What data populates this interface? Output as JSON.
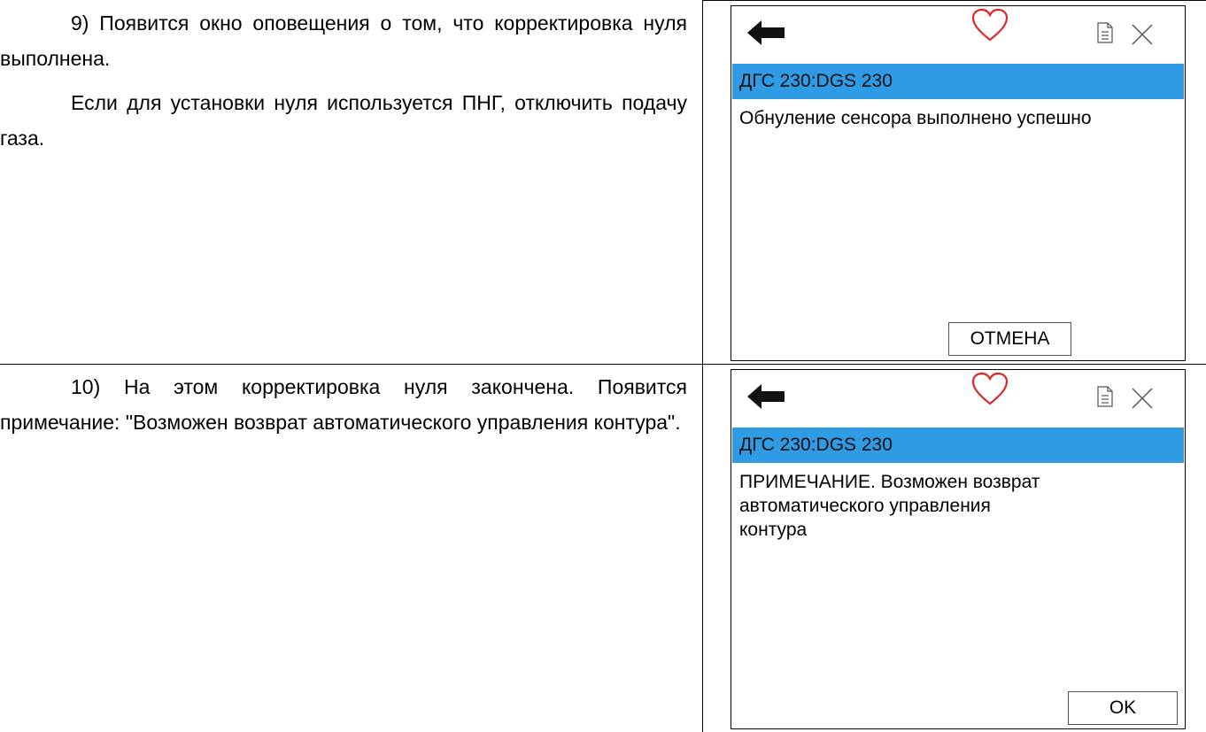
{
  "rows": [
    {
      "step_text": "9) Появится окно оповещения о том, что корректировка нуля выполнена.",
      "step_text_2": "Если для установки нуля используется ПНГ, отключить подачу газа.",
      "screen": {
        "title": "ДГС 230:DGS 230",
        "message": "Обнуление сенсора выполнено успешно",
        "button_label": "ОТМЕНА",
        "icons": [
          "back-arrow-icon",
          "heart-icon",
          "document-icon",
          "close-icon"
        ]
      }
    },
    {
      "step_text": "10) На этом корректировка нуля закончена. Появится примечание: \"Возможен возврат автоматического управления контура\".",
      "screen": {
        "title": "ДГС 230:DGS 230",
        "message": "ПРИМЕЧАНИЕ. Возможен возврат автоматического управления контура",
        "button_label": "OK",
        "icons": [
          "back-arrow-icon",
          "heart-icon",
          "document-icon",
          "close-icon"
        ]
      }
    }
  ],
  "colors": {
    "titlebar": "#2f9be4",
    "heart": "#e0262b",
    "arrow": "#111111"
  }
}
